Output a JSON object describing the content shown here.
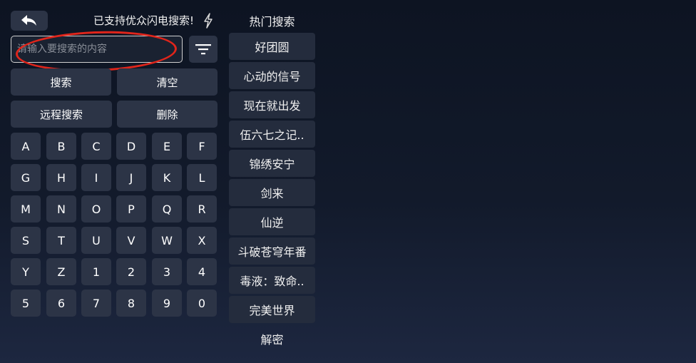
{
  "header": {
    "back_icon": "back-arrow-icon",
    "notice": "已支持优众闪电搜索!",
    "bolt_icon": "lightning-icon"
  },
  "search": {
    "placeholder": "请输入要搜索的内容",
    "value": "",
    "filter_icon": "filter-icon"
  },
  "actions": {
    "search": "搜索",
    "clear": "清空",
    "remote_search": "远程搜索",
    "delete": "删除"
  },
  "keyboard": {
    "rows": [
      [
        "A",
        "B",
        "C",
        "D",
        "E",
        "F"
      ],
      [
        "G",
        "H",
        "I",
        "J",
        "K",
        "L"
      ],
      [
        "M",
        "N",
        "O",
        "P",
        "Q",
        "R"
      ],
      [
        "S",
        "T",
        "U",
        "V",
        "W",
        "X"
      ],
      [
        "Y",
        "Z",
        "1",
        "2",
        "3",
        "4"
      ],
      [
        "5",
        "6",
        "7",
        "8",
        "9",
        "0"
      ]
    ]
  },
  "hot": {
    "title": "热门搜索",
    "items": [
      "好团圆",
      "心动的信号",
      "现在就出发",
      "伍六七之记..",
      "锦绣安宁",
      "剑来",
      "仙逆",
      "斗破苍穹年番",
      "毒液：致命..",
      "完美世界",
      "解密"
    ]
  },
  "colors": {
    "highlight_oval": "#e0251b",
    "button_bg": "#2c3446"
  }
}
